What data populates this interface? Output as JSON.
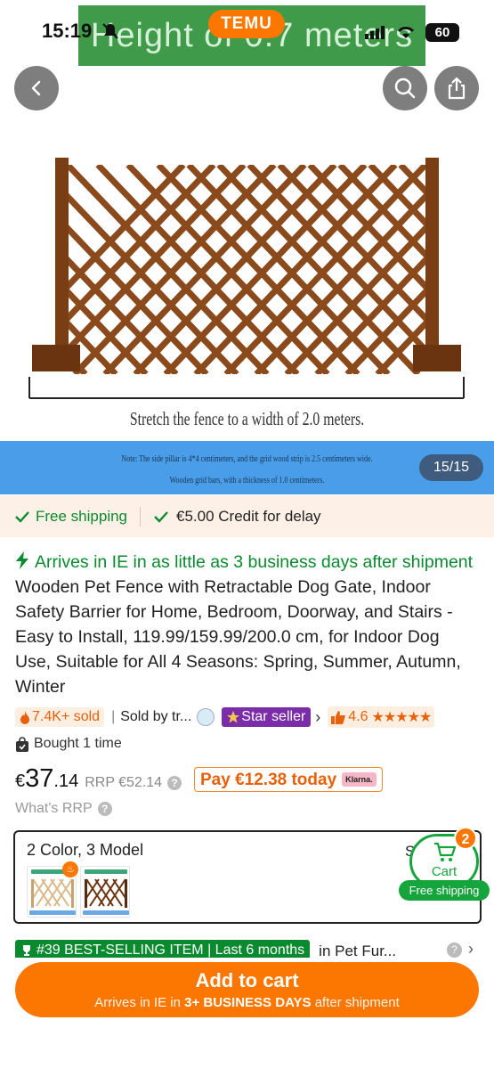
{
  "status_bar": {
    "time": "15:19",
    "battery": "60"
  },
  "hero": {
    "banner_text": "Height of 0.7 meters",
    "brand_badge": "TEMU",
    "stretch_caption": "Stretch the fence to a width of 2.0 meters.",
    "note_line1": "Note: The side pillar is 4*4 centimeters, and the grid wood strip is 2.5 centimeters wide.",
    "note_line2": "Wooden grid bars, with a thickness of 1.0 centimeters.",
    "image_counter": "15/15"
  },
  "shipping": {
    "free_shipping": "Free shipping",
    "credit": "€5.00 Credit for delay"
  },
  "title": {
    "arrival": "Arrives in IE in as little as  3 business days after shipment",
    "name": " Wooden Pet Fence with Retractable Dog Gate, Indoor Safety Barrier for Home, Bedroom, Doorway, and Stairs - Easy to Install, 119.99/159.99/200.0 cm, for Indoor Dog Use, Suitable for All 4 Seasons: Spring, Summer, Autumn, Winter"
  },
  "meta": {
    "sold": "7.4K+ sold",
    "sold_by": "Sold by tr...",
    "star_seller": "Star seller",
    "rating": "4.6",
    "stars": "★★★★★"
  },
  "bought": "Bought 1 time",
  "price": {
    "currency": "€",
    "whole": "37",
    "cents": ".14",
    "rrp": "RRP €52.14",
    "pay_today": "Pay €12.38 today",
    "klarna": "Klarna.",
    "whats_rrp": "What's RRP"
  },
  "variant": {
    "label": "2 Color, 3 Model",
    "size_letter": "S"
  },
  "cart_float": {
    "count": "2",
    "label": "Cart",
    "free_shipping": "Free shipping"
  },
  "best_selling": {
    "badge": "#39 BEST-SELLING ITEM | Last 6 months",
    "category": "in Pet Fur..."
  },
  "add_to_cart": {
    "title": "Add to cart",
    "sub_prefix": "Arrives in IE in ",
    "sub_bold": "3+ BUSINESS DAYS",
    "sub_suffix": " after shipment"
  },
  "colors": {
    "brand_orange": "#fb7701",
    "green": "#0a8a2f",
    "star_seller_purple": "#7b2ca8",
    "note_blue": "#4a9de8"
  }
}
